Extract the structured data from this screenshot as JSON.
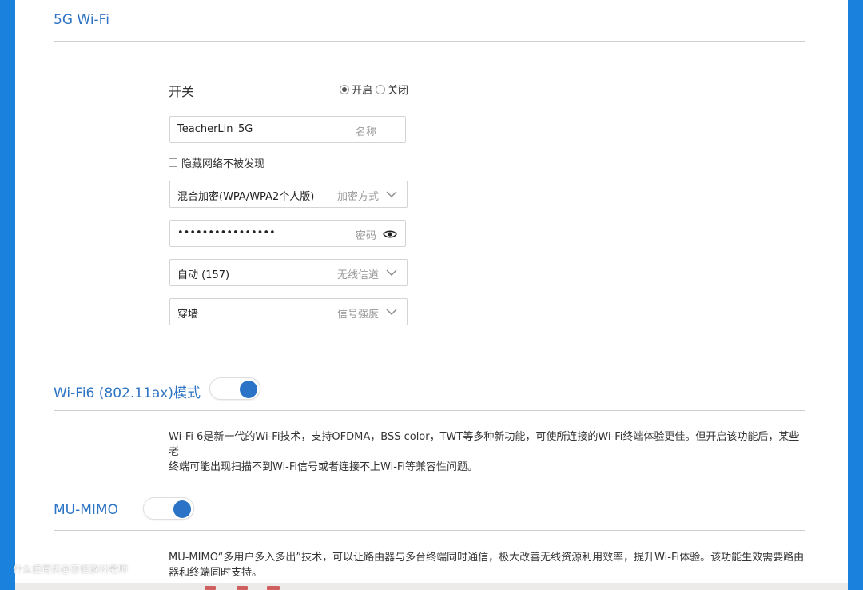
{
  "section_5g": {
    "title": "5G Wi-Fi"
  },
  "switch": {
    "label": "开关",
    "options": [
      {
        "label": "开启",
        "checked": true
      },
      {
        "label": "关闭",
        "checked": false
      }
    ]
  },
  "ssid": {
    "value": "TeacherLin_5G",
    "hint": "名称"
  },
  "hide_network": {
    "label": "隐藏网络不被发现",
    "checked": false
  },
  "encryption": {
    "value": "混合加密(WPA/WPA2个人版)",
    "hint": "加密方式"
  },
  "password": {
    "value": "••••••••••••••••",
    "hint": "密码"
  },
  "channel": {
    "value": "自动 (157)",
    "hint": "无线信道"
  },
  "signal": {
    "value": "穿墙",
    "hint": "信号强度"
  },
  "wifi6": {
    "title": "Wi-Fi6 (802.11ax)模式",
    "enabled": true,
    "desc_line1": "Wi-Fi 6是新一代的Wi-Fi技术，支持OFDMA，BSS color，TWT等多种新功能，可使所连接的Wi-Fi终端体验更佳。但开启该功能后，某些老",
    "desc_line2": "终端可能出现扫描不到Wi-Fi信号或者连接不上Wi-Fi等兼容性问题。"
  },
  "mumimo": {
    "title": "MU-MIMO",
    "enabled": true,
    "desc_line1": "MU-MIMO“多用户多入多出”技术，可以让路由器与多台终端同时通信，极大改善无线资源利用效率，提升Wi-Fi体验。该功能生效需要路由",
    "desc_line2": "器和终端同时支持。"
  },
  "watermark": "什么值得买@茶信族林老师",
  "colors": {
    "accent": "#2d74c5",
    "toggle_on": "#2a73c6",
    "edge": "#1a82dc"
  }
}
